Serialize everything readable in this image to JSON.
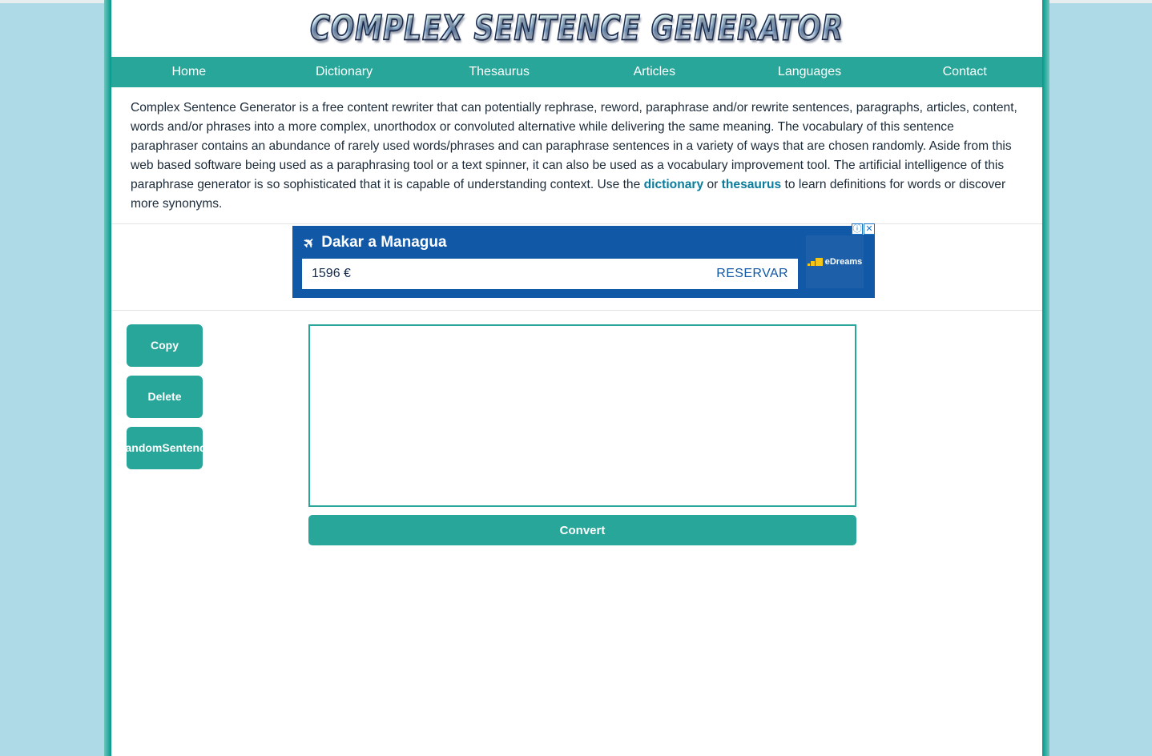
{
  "site": {
    "logo_text": "Complex Sentence Generator",
    "accent_color": "#27a699",
    "background_color": "#aed9e6",
    "border_color": "#00998a",
    "link_color": "#0b7c9c"
  },
  "nav": {
    "items": [
      {
        "label": "Home"
      },
      {
        "label": "Dictionary"
      },
      {
        "label": "Thesaurus"
      },
      {
        "label": "Articles"
      },
      {
        "label": "Languages"
      },
      {
        "label": "Contact"
      }
    ]
  },
  "intro": {
    "part1": "Complex Sentence Generator is a free content rewriter that can potentially rephrase, reword, paraphrase and/or rewrite sentences, paragraphs, articles, content, words and/or phrases into a more complex, unorthodox or convoluted alternative while delivering the same meaning. The vocabulary of this sentence paraphraser contains an abundance of rarely used words/phrases and can paraphrase sentences in a variety of ways that are chosen randomly. Aside from this web based software being used as a paraphrasing tool or a text spinner, it can also be used as a vocabulary improvement tool. The artificial intelligence of this paraphrase generator is so sophisticated that it is capable of understanding context. Use the ",
    "link_dictionary": "dictionary",
    "separator": " or ",
    "link_thesaurus": "thesaurus",
    "part2": " to learn definitions for words or discover more synonyms."
  },
  "ad": {
    "title": "Dakar a Managua",
    "price": "1596 €",
    "cta": "RESERVAR",
    "advertiser": "eDreams",
    "info_icon": "ⓘ",
    "close_icon": "✕",
    "plane_icon": "✈",
    "background_color": "#1158a6"
  },
  "tool": {
    "buttons": {
      "copy": "Copy",
      "delete": "Delete",
      "random": "Random\nSentence",
      "random_line1": "Random",
      "random_line2": "Sentence"
    },
    "textarea": {
      "value": "",
      "placeholder": ""
    },
    "convert_label": "Convert"
  }
}
